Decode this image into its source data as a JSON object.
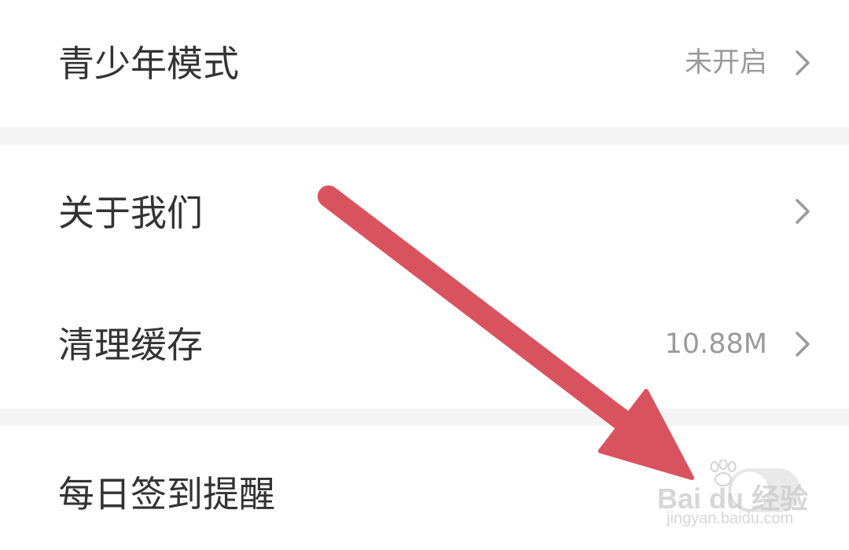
{
  "settings": {
    "items": [
      {
        "label": "青少年模式",
        "value": "未开启",
        "icon": "chevron-right-icon"
      },
      {
        "label": "关于我们",
        "value": "",
        "icon": "chevron-right-icon"
      },
      {
        "label": "清理缓存",
        "value": "10.88M",
        "icon": "chevron-right-icon"
      },
      {
        "label": "每日签到提醒",
        "control": "toggle",
        "toggle_on": false
      }
    ]
  },
  "annotation": {
    "color": "#d9535e",
    "icon": "arrow-annotation"
  },
  "watermark": {
    "logo_text": "Bai du 经验",
    "url_text": "jingyan.baidu.com"
  }
}
